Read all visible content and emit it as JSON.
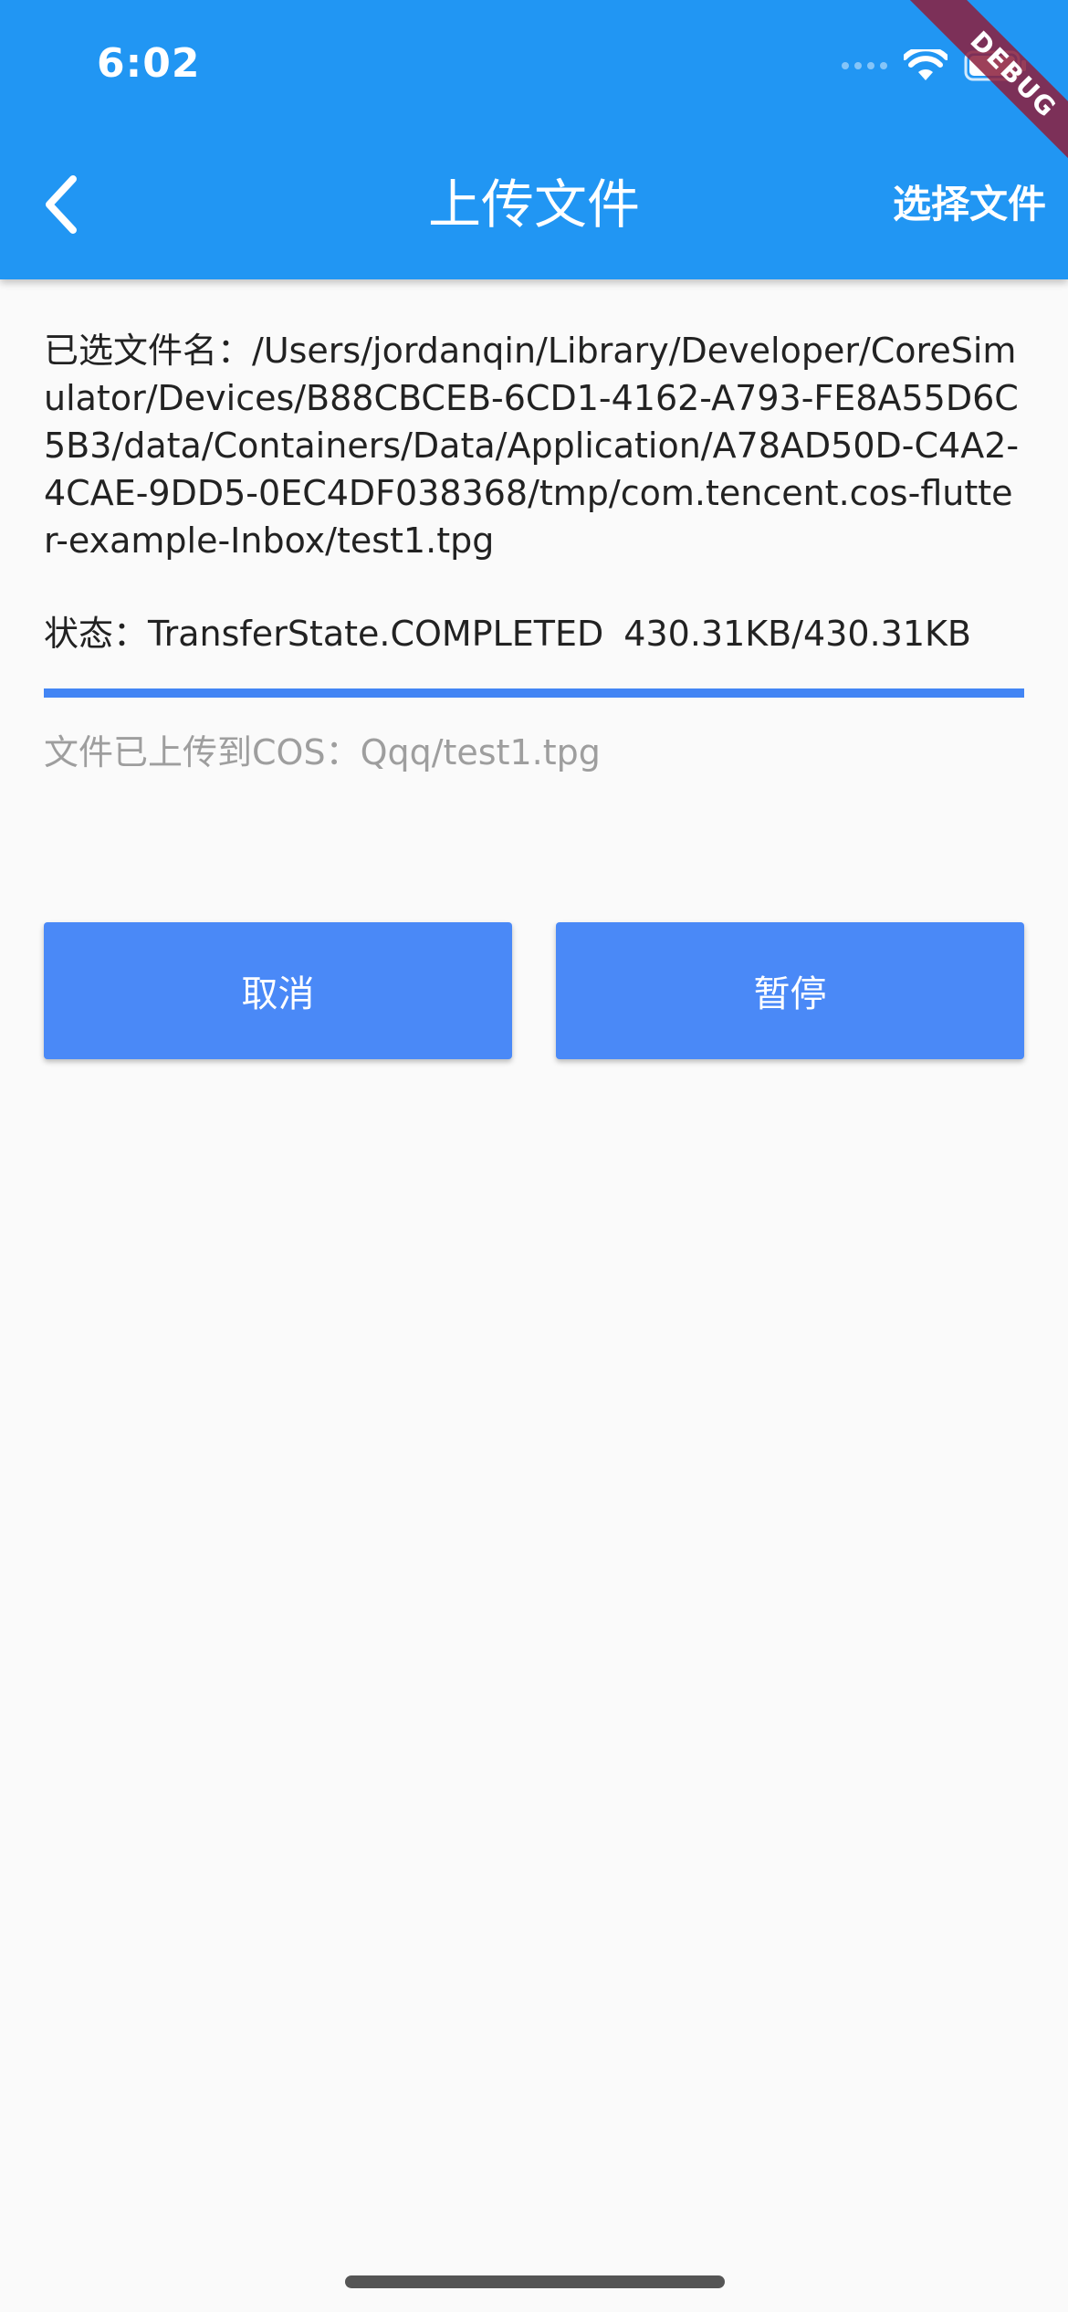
{
  "status_bar": {
    "time": "6:02"
  },
  "debug_banner": {
    "label": "DEBUG"
  },
  "app_bar": {
    "title": "上传文件",
    "action_label": "选择文件"
  },
  "file": {
    "label": "已选文件名：",
    "path": "/Users/jordanqin/Library/Developer/CoreSimulator/Devices/B88CBCEB-6CD1-4162-A793-FE8A55D6C5B3/data/Containers/Data/Application/A78AD50D-C4A2-4CAE-9DD5-0EC4DF038368/tmp/com.tencent.cos-flutter-example-Inbox/test1.tpg"
  },
  "status": {
    "label": "状态：",
    "state": "TransferState.COMPLETED",
    "size": "430.31KB/430.31KB"
  },
  "progress": {
    "fraction": 1.0
  },
  "uploaded": {
    "text": "文件已上传到COS：Qqq/test1.tpg"
  },
  "buttons": {
    "cancel_label": "取消",
    "pause_label": "暂停"
  },
  "colors": {
    "app_bar": "#2196f3",
    "button": "#4a89f7",
    "progress": "#4285f4"
  }
}
